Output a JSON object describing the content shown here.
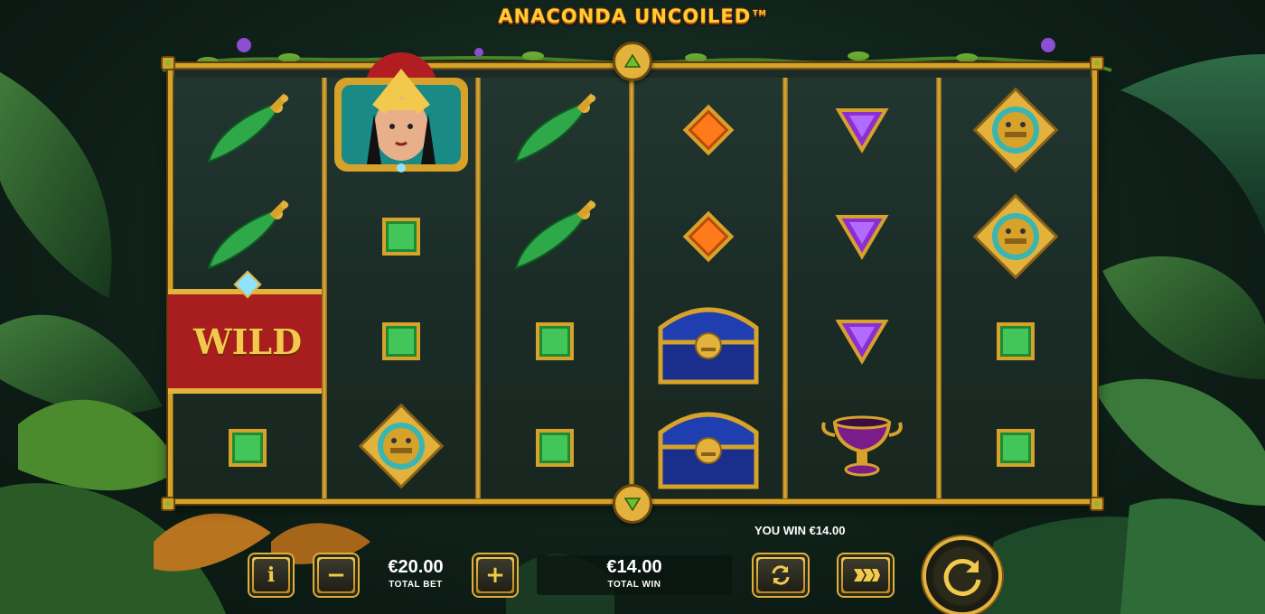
{
  "game": {
    "title": "ANACONDA UNCOILED",
    "trademark": "TM"
  },
  "reels": [
    [
      "green-dagger",
      "green-dagger",
      "wild",
      "green-gem"
    ],
    [
      "queen",
      "queen",
      "green-gem",
      "gold-medallion"
    ],
    [
      "green-dagger",
      "green-dagger",
      "green-gem",
      "green-gem"
    ],
    [
      "orange-gem",
      "orange-gem",
      "treasure-chest",
      "treasure-chest"
    ],
    [
      "purple-triangle-gem",
      "purple-triangle-gem",
      "purple-triangle-gem",
      "purple-goblet"
    ],
    [
      "gold-medallion",
      "gold-medallion",
      "green-gem",
      "green-gem"
    ]
  ],
  "wild_label": "WILD",
  "controls": {
    "info_label": "i",
    "minus_label": "−",
    "plus_label": "+",
    "total_bet_value": "€20.00",
    "total_bet_label": "TOTAL BET",
    "total_win_value": "€14.00",
    "total_win_label": "TOTAL WIN",
    "you_win_text": "YOU WIN €14.00"
  },
  "colors": {
    "frame_gold": "#d7a22a",
    "reel_bg": "#1c2b26",
    "accent_gold": "#f2c94c"
  }
}
